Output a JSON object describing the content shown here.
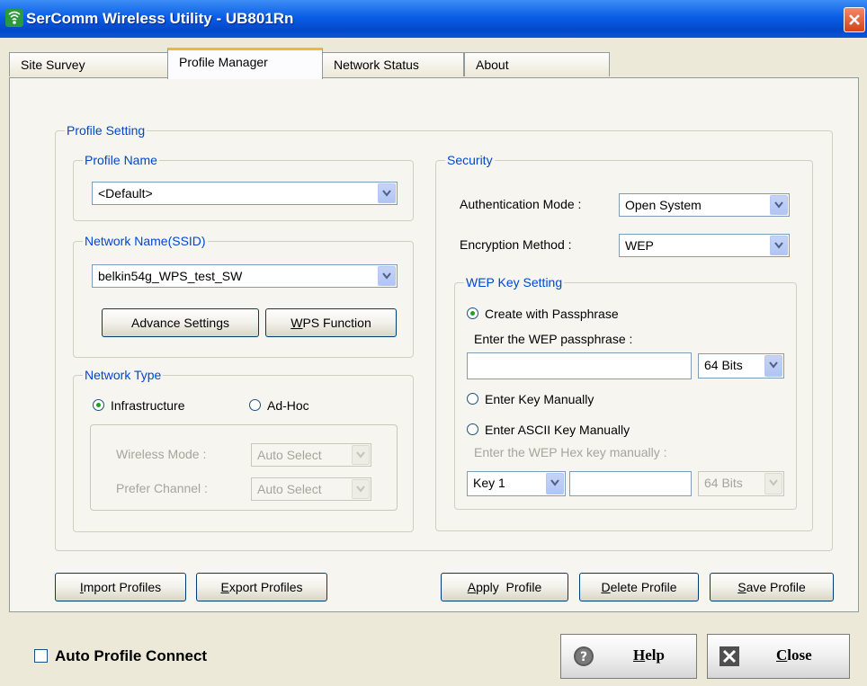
{
  "window": {
    "title": "SerComm Wireless Utility - UB801Rn"
  },
  "tabs": [
    "Site Survey",
    "Profile Manager",
    "Network Status",
    "About"
  ],
  "profile_setting": {
    "legend": "Profile Setting",
    "profile_name": {
      "legend": "Profile Name",
      "value": "<Default>"
    },
    "ssid": {
      "legend": "Network Name(SSID)",
      "value": "belkin54g_WPS_test_SW"
    },
    "advance_settings": "Advance Settings",
    "wps_function": {
      "mnemonic": "W",
      "rest": "PS Function"
    },
    "network_type": {
      "legend": "Network Type",
      "infrastructure": "Infrastructure",
      "adhoc": "Ad-Hoc",
      "wireless_mode_label": "Wireless Mode :",
      "wireless_mode_value": "Auto Select",
      "prefer_channel_label": "Prefer Channel :",
      "prefer_channel_value": "Auto Select"
    }
  },
  "security": {
    "legend": "Security",
    "auth_label": "Authentication Mode :",
    "auth_value": "Open System",
    "enc_label": "Encryption Method :",
    "enc_value": "WEP",
    "wep": {
      "legend": "WEP Key Setting",
      "create_passphrase": "Create with Passphrase",
      "enter_passphrase_label": "Enter the WEP passphrase :",
      "passphrase_bits": "64 Bits",
      "enter_key_manually": "Enter Key Manually",
      "enter_ascii_manually": "Enter ASCII Key Manually",
      "enter_hex_label": "Enter the WEP Hex key manually :",
      "key_index": "Key 1",
      "hex_bits": "64 Bits"
    }
  },
  "actions": {
    "import": {
      "mnemonic": "I",
      "rest": "mport Profiles"
    },
    "export": {
      "mnemonic": "E",
      "rest": "xport Profiles"
    },
    "apply": {
      "mnemonic": "A",
      "rest": "pply  Profile"
    },
    "delete": {
      "mnemonic": "D",
      "rest": "elete Profile"
    },
    "save": {
      "mnemonic": "S",
      "rest": "ave Profile"
    }
  },
  "footer": {
    "auto_connect": "Auto Profile Connect",
    "help": {
      "mnemonic": "H",
      "rest": "elp"
    },
    "close": {
      "mnemonic": "C",
      "rest": "lose"
    }
  }
}
